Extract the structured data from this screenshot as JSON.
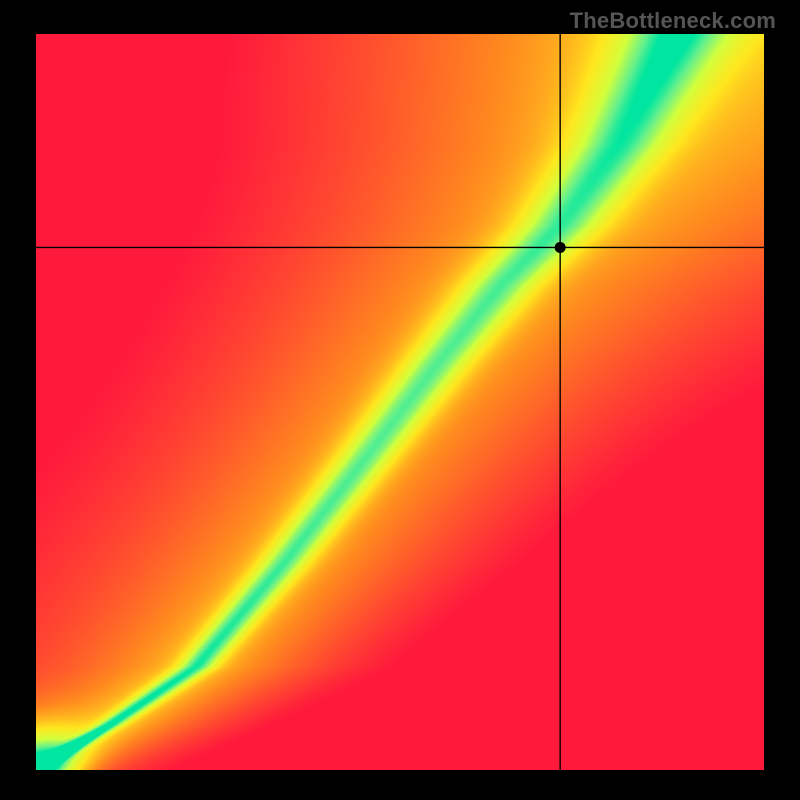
{
  "watermark": "TheBottleneck.com",
  "chart_data": {
    "type": "heatmap",
    "title": "",
    "xlabel": "",
    "ylabel": "",
    "xlim": [
      0,
      100
    ],
    "ylim": [
      0,
      100
    ],
    "x_ticks": [],
    "y_ticks": [],
    "marker": {
      "x": 72,
      "y": 71
    },
    "crosshair": {
      "x": 72,
      "y": 71
    },
    "ridge_curve": {
      "description": "Central green optimum band running from bottom-left to upper-right with an S-bend; band widens toward the top.",
      "control_points_x": [
        0,
        10,
        22,
        34,
        45,
        55,
        64,
        72,
        80,
        88
      ],
      "control_points_y": [
        0,
        6,
        14,
        28,
        42,
        55,
        66,
        74,
        85,
        100
      ],
      "half_width_at_y": [
        1.2,
        1.8,
        2.6,
        3.4,
        4.0,
        4.6,
        5.2,
        5.8,
        6.6,
        8.0
      ]
    },
    "color_scale": {
      "stops": [
        {
          "t": 0.0,
          "hex": "#ff1a3c"
        },
        {
          "t": 0.35,
          "hex": "#ff8a1e"
        },
        {
          "t": 0.6,
          "hex": "#ffe61e"
        },
        {
          "t": 0.78,
          "hex": "#d2ff3c"
        },
        {
          "t": 0.92,
          "hex": "#64f08c"
        },
        {
          "t": 1.0,
          "hex": "#00e6a0"
        }
      ]
    }
  }
}
